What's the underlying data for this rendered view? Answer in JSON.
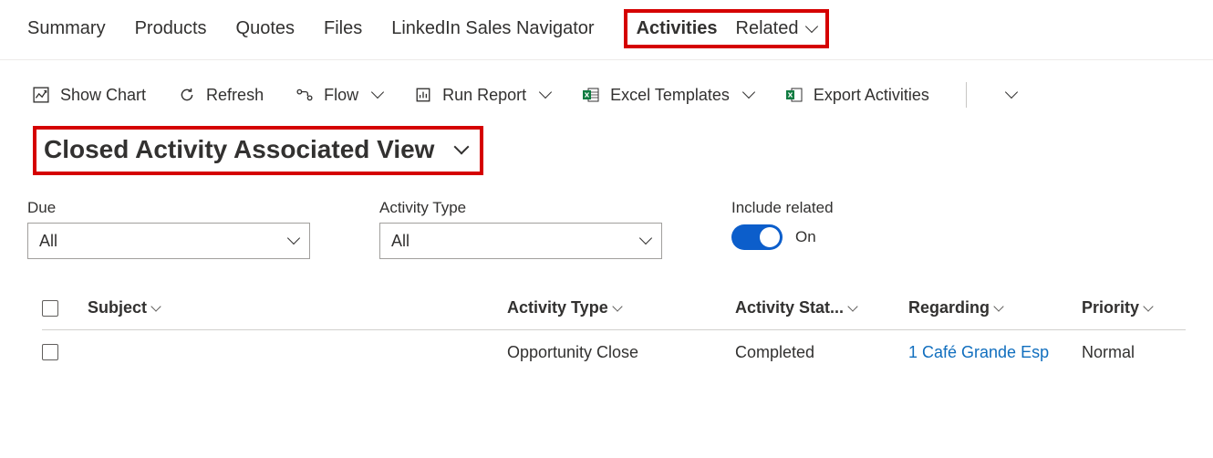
{
  "tabs": {
    "summary": "Summary",
    "products": "Products",
    "quotes": "Quotes",
    "files": "Files",
    "linkedin": "LinkedIn Sales Navigator",
    "activities": "Activities",
    "related": "Related"
  },
  "commands": {
    "show_chart": "Show Chart",
    "refresh": "Refresh",
    "flow": "Flow",
    "run_report": "Run Report",
    "excel_templates": "Excel Templates",
    "export_activities": "Export Activities"
  },
  "view": {
    "title": "Closed Activity Associated View"
  },
  "filters": {
    "due_label": "Due",
    "due_value": "All",
    "type_label": "Activity Type",
    "type_value": "All",
    "include_related_label": "Include related",
    "include_related_state": "On"
  },
  "columns": {
    "subject": "Subject",
    "activity_type": "Activity Type",
    "activity_status": "Activity Stat...",
    "regarding": "Regarding",
    "priority": "Priority"
  },
  "rows": [
    {
      "subject": "",
      "activity_type": "Opportunity Close",
      "activity_status": "Completed",
      "regarding": "1 Café Grande Esp",
      "priority": "Normal"
    }
  ]
}
